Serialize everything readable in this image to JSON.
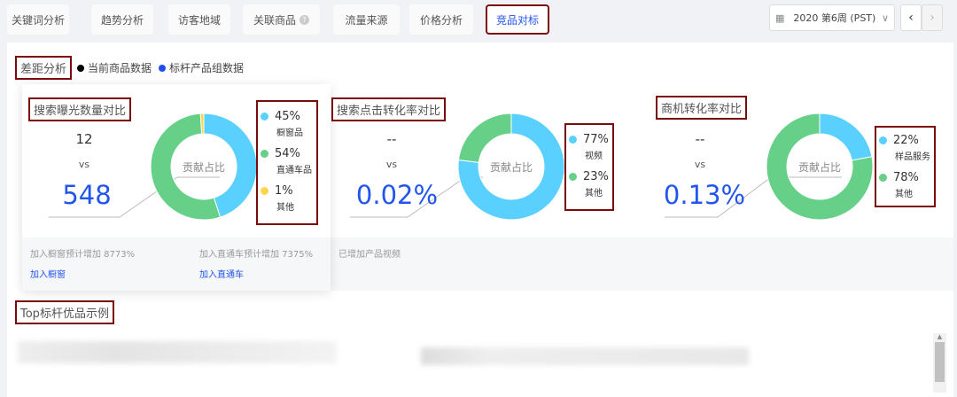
{
  "tabs": [
    {
      "label": "关键词分析"
    },
    {
      "label": "趋势分析"
    },
    {
      "label": "访客地域"
    },
    {
      "label": "关联商品"
    },
    {
      "label": "流量来源"
    },
    {
      "label": "价格分析"
    },
    {
      "label": "竞品对标"
    }
  ],
  "date_picker": {
    "value": "2020 第6周 (PST)"
  },
  "section": {
    "title": "差距分析",
    "legend": [
      {
        "label": "当前商品数据",
        "color": "#000000"
      },
      {
        "label": "标杆产品组数据",
        "color": "#1f4ef0"
      }
    ]
  },
  "center_label": "贡献占比",
  "vs_label": "vs",
  "cards": [
    {
      "title": "搜索曝光数量对比",
      "current": "12",
      "benchmark": "548",
      "slices": [
        {
          "pct": "45%",
          "value": 45,
          "label": "橱窗品",
          "color": "#5ad0ff"
        },
        {
          "pct": "54%",
          "value": 54,
          "label": "直通车品",
          "color": "#66d088"
        },
        {
          "pct": "1%",
          "value": 1,
          "label": "其他",
          "color": "#ffd54a"
        }
      ],
      "footer": [
        {
          "text": "加入橱窗预计增加 8773%",
          "link": "加入橱窗"
        },
        {
          "text": "加入直通车预计增加 7375%",
          "link": "加入直通车"
        }
      ]
    },
    {
      "title": "搜索点击转化率对比",
      "current": "--",
      "benchmark": "0.02%",
      "slices": [
        {
          "pct": "77%",
          "value": 77,
          "label": "视频",
          "color": "#5ad0ff"
        },
        {
          "pct": "23%",
          "value": 23,
          "label": "其他",
          "color": "#66d088"
        }
      ],
      "footer": [
        {
          "text": "已增加产品视频"
        }
      ]
    },
    {
      "title": "商机转化率对比",
      "current": "--",
      "benchmark": "0.13%",
      "slices": [
        {
          "pct": "22%",
          "value": 22,
          "label": "样品服务",
          "color": "#5ad0ff"
        },
        {
          "pct": "78%",
          "value": 78,
          "label": "其他",
          "color": "#66d088"
        }
      ]
    }
  ],
  "top_section": {
    "title": "Top标杆优品示例"
  }
}
